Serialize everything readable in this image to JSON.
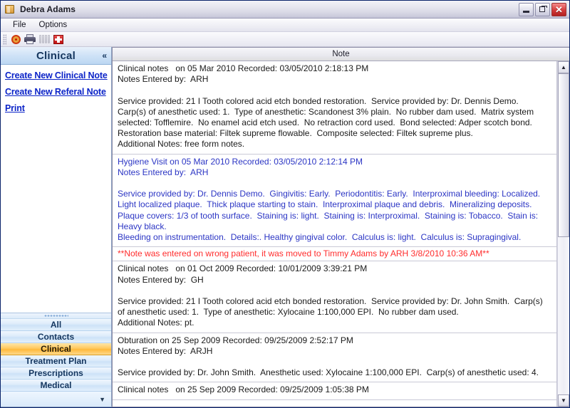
{
  "window": {
    "title": "Debra Adams",
    "icon": "patient-folder-icon",
    "buttons": {
      "minimize": "minimize-button",
      "restore": "restore-button",
      "close_label": "✕"
    }
  },
  "menubar": {
    "items": [
      {
        "label": "File"
      },
      {
        "label": "Options"
      }
    ]
  },
  "toolbar": {
    "buttons": [
      {
        "icon": "record-target-icon",
        "enabled": true
      },
      {
        "icon": "printer-icon",
        "enabled": true
      },
      {
        "icon": "teeth-chart-icon",
        "enabled": false
      },
      {
        "icon": "medical-cross-icon",
        "enabled": true
      }
    ]
  },
  "sidebar": {
    "header": {
      "title": "Clinical",
      "collapse_glyph": "«"
    },
    "links": [
      {
        "label": "Create New Clinical Note"
      },
      {
        "label": "Create New Referal Note"
      },
      {
        "label": "Print"
      }
    ],
    "nav": {
      "items": [
        {
          "label": "All",
          "active": false
        },
        {
          "label": "Contacts",
          "active": false
        },
        {
          "label": "Clinical",
          "active": true
        },
        {
          "label": "Treatment Plan",
          "active": false
        },
        {
          "label": "Prescriptions",
          "active": false
        },
        {
          "label": "Medical",
          "active": false
        }
      ],
      "footer_caret": "▼"
    }
  },
  "notes": {
    "column_header": "Note",
    "blocks": [
      {
        "color": "black",
        "text": "Clinical notes   on 05 Mar 2010 Recorded: 03/05/2010 2:18:13 PM\nNotes Entered by:  ARH\n\nService provided: 21 I Tooth colored acid etch bonded restoration.  Service provided by: Dr. Dennis Demo.  Carp(s) of anesthetic used: 1.  Type of anesthetic: Scandonest 3% plain.  No rubber dam used.  Matrix system selected: Tofflemire.  No enamel acid etch used.  No retraction cord used.  Bond selected: Adper scotch bond.  Restoration base material: Filtek supreme flowable.  Composite selected: Filtek supreme plus.\nAdditional Notes: free form notes."
      },
      {
        "color": "blue",
        "text": "Hygiene Visit on 05 Mar 2010 Recorded: 03/05/2010 2:12:14 PM\nNotes Entered by:  ARH\n\nService provided by: Dr. Dennis Demo.  Gingivitis: Early.  Periodontitis: Early.  Interproximal bleeding: Localized.  Light localized plaque.  Thick plaque starting to stain.  Interproximal plaque and debris.  Mineralizing deposits.   Plaque covers: 1/3 of tooth surface.  Staining is: light.  Staining is: Interproximal.  Staining is: Tobacco.  Stain is: Heavy black.\nBleeding on instrumentation.  Details:. Healthy gingival color.  Calculus is: light.  Calculus is: Supragingival."
      },
      {
        "color": "red",
        "text": "**Note was entered on wrong patient, it was moved to Timmy Adams by ARH 3/8/2010 10:36 AM**"
      },
      {
        "color": "black",
        "text": "Clinical notes   on 01 Oct 2009 Recorded: 10/01/2009 3:39:21 PM\nNotes Entered by:  GH\n\nService provided: 21 I Tooth colored acid etch bonded restoration.  Service provided by: Dr. John Smith.  Carp(s) of anesthetic used: 1.  Type of anesthetic: Xylocaine 1:100,000 EPI.  No rubber dam used.\nAdditional Notes: pt."
      },
      {
        "color": "black",
        "text": "Obturation on 25 Sep 2009 Recorded: 09/25/2009 2:52:17 PM\nNotes Entered by:  ARJH\n\nService provided by: Dr. John Smith.  Anesthetic used: Xylocaine 1:100,000 EPI.  Carp(s) of anesthetic used: 4."
      },
      {
        "color": "black",
        "text": "Clinical notes   on 25 Sep 2009 Recorded: 09/25/2009 1:05:38 PM"
      }
    ]
  },
  "scrollbar": {
    "up_glyph": "▲",
    "down_glyph": "▼"
  }
}
